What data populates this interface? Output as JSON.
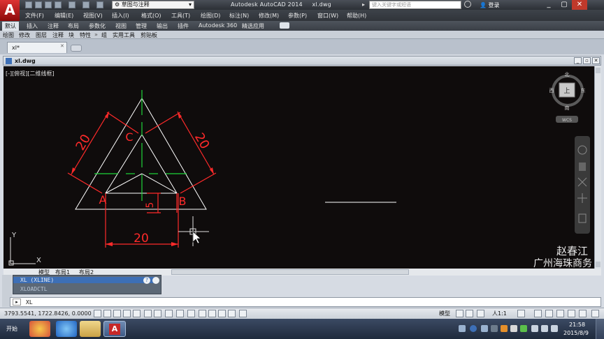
{
  "title_bar": {
    "app_logo": "A",
    "workspace": "草图与注释",
    "app_title": "Autodesk AutoCAD 2014",
    "file_name": "xl.dwg",
    "search_placeholder": "键入关键字或短语",
    "login": "登录"
  },
  "menu": [
    "文件(F)",
    "编辑(E)",
    "视图(V)",
    "插入(I)",
    "格式(O)",
    "工具(T)",
    "绘图(D)",
    "标注(N)",
    "修改(M)",
    "参数(P)",
    "窗口(W)",
    "帮助(H)"
  ],
  "ribbon_tabs": [
    "默认",
    "插入",
    "注释",
    "布局",
    "参数化",
    "视图",
    "管理",
    "输出",
    "插件",
    "Autodesk 360",
    "精选应用"
  ],
  "ribbon_panels": [
    "绘图",
    "修改",
    "图层",
    "注释",
    "块",
    "特性",
    "组",
    "实用工具",
    "剪贴板"
  ],
  "file_tab": {
    "label": "xl*"
  },
  "drawing_window": {
    "title": "xl.dwg",
    "viewport_label": "[-][俯视][二维线框]",
    "viewcube": {
      "north": "北",
      "south": "南",
      "east": "东",
      "west": "西",
      "top": "上",
      "wcs": "WCS"
    },
    "watermark_line1": "赵春江",
    "watermark_line2": "广州海珠商务",
    "ucs": {
      "x": "X",
      "y": "Y"
    }
  },
  "drawing": {
    "vertices": {
      "a": "A",
      "b": "B",
      "c": "C"
    },
    "dims": {
      "left_side": "20",
      "right_side": "20",
      "base": "20",
      "offset": "5"
    },
    "colors": {
      "geometry": "#ffffff",
      "dimension": "#ff2a2a",
      "centerline": "#1fd63a"
    }
  },
  "layout_tabs": [
    "模型",
    "布局1",
    "布局2"
  ],
  "command": {
    "history": [
      "XL (XLINE)",
      "XLOADCTL"
    ],
    "input": "XL"
  },
  "status": {
    "coords": "3793.5541, 1722.8426, 0.0000",
    "model": "模型",
    "scale": "人1:1"
  },
  "taskbar": {
    "start": "开始",
    "time": "21:58",
    "date": "2015/8/9"
  }
}
